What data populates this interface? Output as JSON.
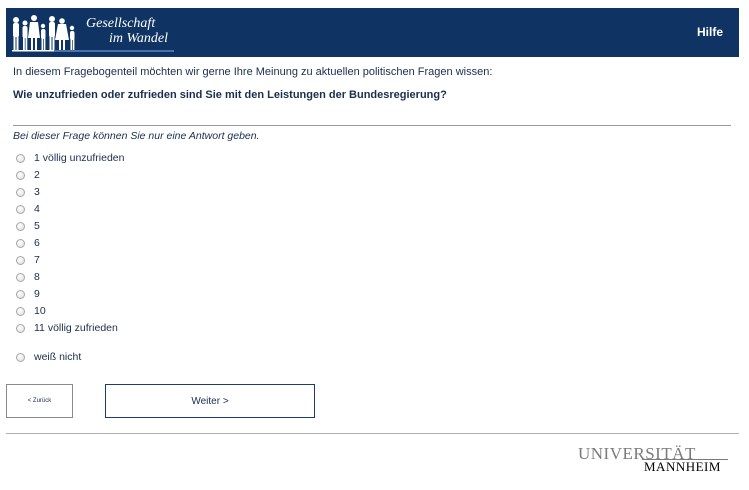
{
  "header": {
    "logo_line1": "Gesellschaft",
    "logo_line2": "im Wandel",
    "help_label": "Hilfe",
    "background_color": "#0f3363",
    "logo_icon": "people-silhouettes-icon"
  },
  "intro_text": "In diesem Fragebogenteil möchten wir gerne Ihre Meinung zu aktuellen politischen Fragen wissen:",
  "question_text": "Wie unzufrieden oder zufrieden sind Sie mit den Leistungen der Bundesregierung?",
  "hint_text": "Bei dieser Frage können Sie nur eine Antwort geben.",
  "options": [
    {
      "label": "1 völlig unzufrieden"
    },
    {
      "label": "2"
    },
    {
      "label": "3"
    },
    {
      "label": "4"
    },
    {
      "label": "5"
    },
    {
      "label": "6"
    },
    {
      "label": "7"
    },
    {
      "label": "8"
    },
    {
      "label": "9"
    },
    {
      "label": "10"
    },
    {
      "label": "11 völlig zufrieden"
    },
    {
      "label": "weiß nicht"
    }
  ],
  "buttons": {
    "back_label": "< Zurück",
    "next_label": "Weiter >"
  },
  "footer": {
    "university_line1": "UNIVERSITÄT",
    "university_line2": "MANNHEIM"
  }
}
